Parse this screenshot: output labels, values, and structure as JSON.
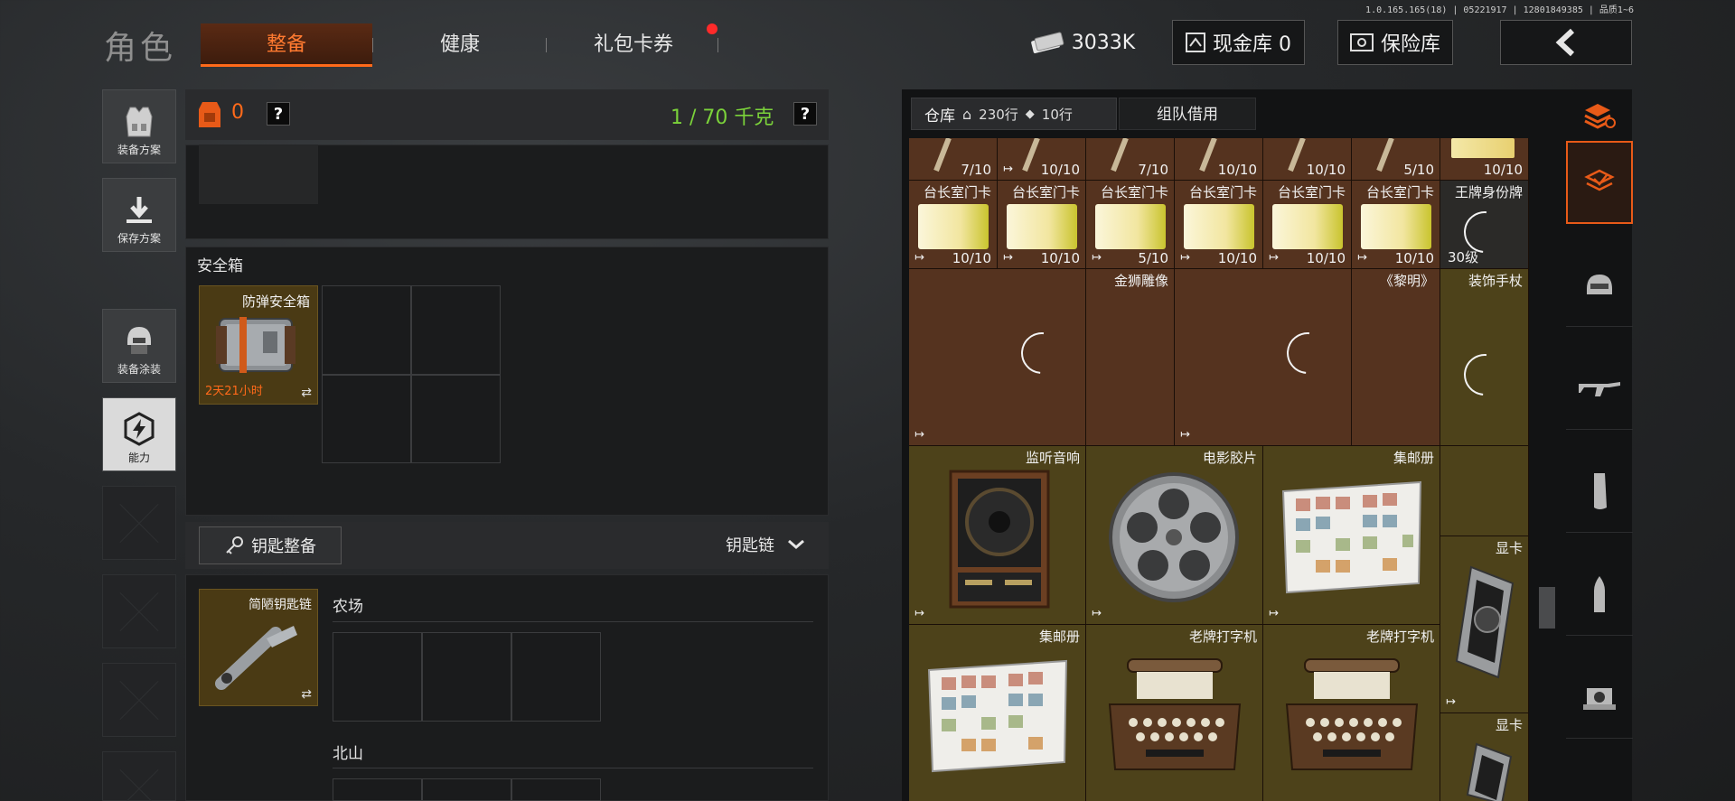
{
  "version": "1.0.165.165(18) | 05221917 | 12801849385 | 品质1~6",
  "header": {
    "title": "角色",
    "tabs": [
      {
        "label": "整备",
        "active": true
      },
      {
        "label": "健康",
        "active": false
      },
      {
        "label": "礼包卡券",
        "active": false
      }
    ],
    "currency": "3033K",
    "cash_vault": "现金库 0",
    "safe_vault": "保险库",
    "back_icon": "chevron-left-icon"
  },
  "sidebar": {
    "items": [
      {
        "label": "装备方案",
        "icon": "vest-icon"
      },
      {
        "label": "保存方案",
        "icon": "download-icon"
      },
      {
        "label": "装备涂装",
        "icon": "helmet-icon"
      },
      {
        "label": "能力",
        "icon": "lightning-icon",
        "active": true
      }
    ]
  },
  "loadout": {
    "backpack_count": "0",
    "weight": "1 / 70 千克",
    "help": "?",
    "safebox_title": "安全箱",
    "safebox_item": {
      "name": "防弹安全箱",
      "timer": "2天21小时"
    },
    "key_button": "钥匙整备",
    "keychain_label": "钥匙链",
    "key_item": "简陋钥匙链",
    "farm_label": "农场",
    "north_label": "北山"
  },
  "warehouse": {
    "tab_label": "仓库",
    "rows1": "230行",
    "rows2": "10行",
    "team_tab": "组队借用",
    "top_counts": [
      "7/10",
      "10/10",
      "7/10",
      "10/10",
      "10/10",
      "5/10",
      "10/10"
    ],
    "cards": [
      {
        "name": "台长室门卡",
        "count": "10/10"
      },
      {
        "name": "台长室门卡",
        "count": "10/10"
      },
      {
        "name": "台长室门卡",
        "count": "5/10"
      },
      {
        "name": "台长室门卡",
        "count": "10/10"
      },
      {
        "name": "台长室门卡",
        "count": "10/10"
      },
      {
        "name": "台长室门卡",
        "count": "10/10"
      }
    ],
    "id_card": {
      "name": "王牌身份牌",
      "level": "30级"
    },
    "row3": {
      "lion": "金狮雕像",
      "dawn": "《黎明》",
      "cane": "装饰手杖"
    },
    "row4": {
      "speaker": "监听音响",
      "film": "电影胶片",
      "album": "集邮册"
    },
    "gpu1": "显卡",
    "row5": {
      "album": "集邮册",
      "typewriter1": "老牌打字机",
      "typewriter2": "老牌打字机"
    },
    "gpu2": "显卡"
  },
  "colors": {
    "accent": "#ff6a1a",
    "weight_green": "#7bd23a",
    "red_dot": "#ff2a2a"
  }
}
